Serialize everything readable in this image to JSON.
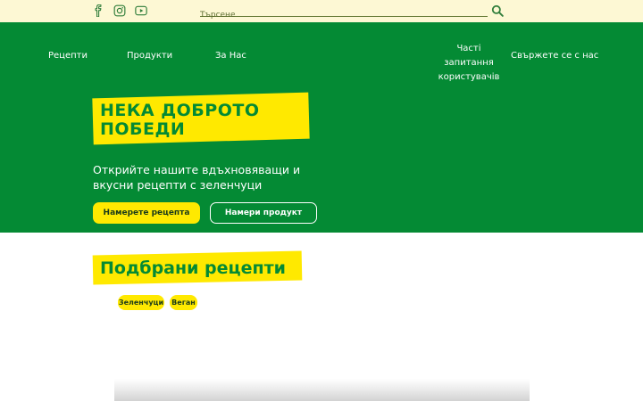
{
  "header": {
    "social": [
      {
        "icon": "facebook-icon"
      },
      {
        "icon": "instagram-icon"
      },
      {
        "icon": "youtube-icon"
      }
    ],
    "search": {
      "placeholder": "Търсене",
      "icon": "search-icon"
    }
  },
  "nav": {
    "items": [
      {
        "label": "Рецепти"
      },
      {
        "label": "Продукти"
      },
      {
        "label": "За Нас"
      }
    ],
    "faq": "Часті запитання користувачів",
    "contact": "Свържете се с нас"
  },
  "hero": {
    "headline": "НЕКА ДОБРОТО ПОБЕДИ",
    "subtitle": "Открийте нашите вдъхновяващи и вкусни рецепти с зеленчуци",
    "primary_button": "Намерете рецепта",
    "secondary_button": "Намери продукт"
  },
  "featured": {
    "title": "Подбрани рецепти",
    "tags": [
      {
        "label": "Зеленчуци"
      },
      {
        "label": "Веган"
      }
    ]
  },
  "colors": {
    "brand_green": "#048a34",
    "accent_yellow": "#ffe900",
    "topbar_bg": "#fdf8d4"
  }
}
